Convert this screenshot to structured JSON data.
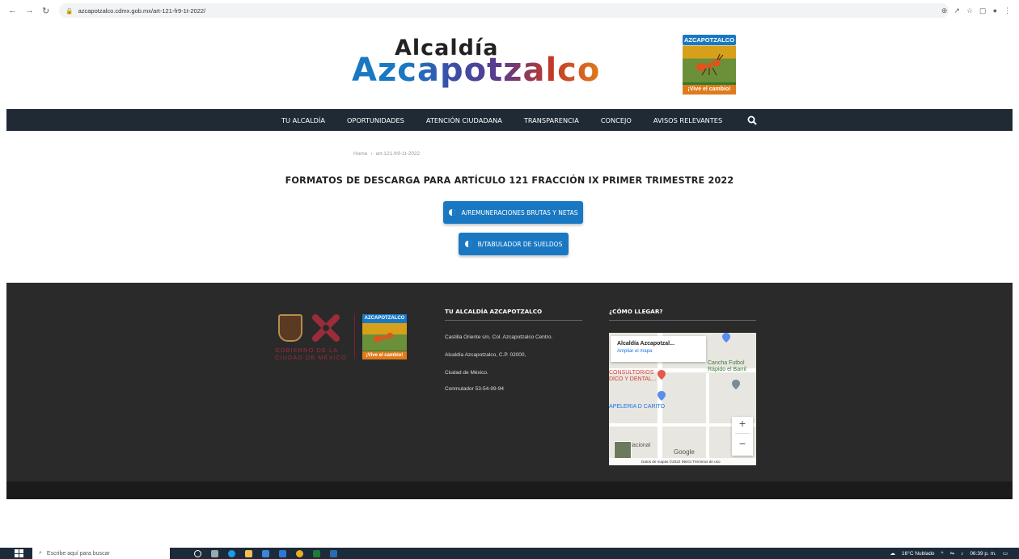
{
  "browser": {
    "url": "azcapotzalco.cdmx.gob.mx/art-121-fr9-1t-2022/"
  },
  "site": {
    "logo_line1": "Alcaldía",
    "logo_line2": "Azcapotzalco",
    "badge_top": "AZCAPOTZALCO",
    "badge_bottom": "¡Vive el cambio!"
  },
  "nav": {
    "items": [
      "TU ALCALDÍA",
      "OPORTUNIDADES",
      "ATENCIÓN CIUDADANA",
      "TRANSPARENCIA",
      "CONCEJO",
      "AVISOS RELEVANTES"
    ]
  },
  "breadcrumb": {
    "home": "Home",
    "separator": "›",
    "current": "art-121-fr9-1t-2022"
  },
  "main": {
    "title": "FORMATOS DE DESCARGA PARA ARTÍCULO 121 FRACCIÓN IX PRIMER TRIMESTRE 2022",
    "buttons": [
      "A/REMUNERACIONES BRUTAS Y NETAS",
      "B/TABULADOR DE SUELDOS"
    ]
  },
  "footer": {
    "gov_text_1": "GOBIERNO DE LA",
    "gov_text_2": "CIUDAD DE MÉXICO",
    "badge_top": "AZCAPOTZALCO",
    "badge_bottom": "¡Vive el cambio!",
    "col1_title": "TU ALCALDÍA AZCAPOTZALCO",
    "col1_lines": [
      "Castilla Oriente s/n, Col. Azcapotzalco Centro.",
      "Alcaldía Azcapotzalco, C.P. 02000,",
      "Ciudad de México.",
      "Conmutador 53-54-99-94"
    ],
    "col2_title": "¿CÓMO LLEGAR?",
    "map": {
      "place_name": "Alcaldía Azcapotzal...",
      "enlarge_link": "Ampliar el mapa",
      "label_1": "Cancha Futbol",
      "label_2": "Rápido el Barril",
      "label_3": "CONSULTORIOS",
      "label_4": "DICO Y DENTAL...",
      "label_5": "APELERIA D CARITO",
      "label_6": "Nacional",
      "label_7": "Google",
      "attribution": "Datos de mapas ©2022 INEGI   Términos de uso"
    }
  },
  "taskbar": {
    "search_placeholder": "Escribe aquí para buscar",
    "weather": "16°C  Nublado",
    "time": "06:39 p. m."
  }
}
